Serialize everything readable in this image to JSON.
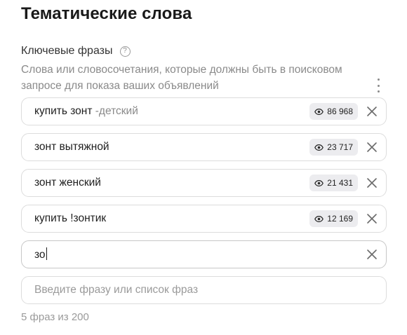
{
  "section": {
    "title": "Тематические слова",
    "label": "Ключевые фразы",
    "help_symbol": "?",
    "description": "Слова или словосочетания, которые должны быть в поисковом запросе для показа ваших объявлений"
  },
  "phrases": [
    {
      "text": "купить зонт",
      "minus": "-детский",
      "count": "86 968"
    },
    {
      "text": "зонт вытяжной",
      "minus": "",
      "count": "23 717"
    },
    {
      "text": "зонт женский",
      "minus": "",
      "count": "21 431"
    },
    {
      "text": "купить !зонтик",
      "minus": "",
      "count": "12 169"
    }
  ],
  "active_input": {
    "value": "зо"
  },
  "new_input": {
    "placeholder": "Введите фразу или список фраз"
  },
  "counter": "5 фраз из 200",
  "icons": {
    "eye": "eye-icon",
    "close": "close-icon",
    "help": "help-icon",
    "menu": "kebab-menu-icon"
  }
}
